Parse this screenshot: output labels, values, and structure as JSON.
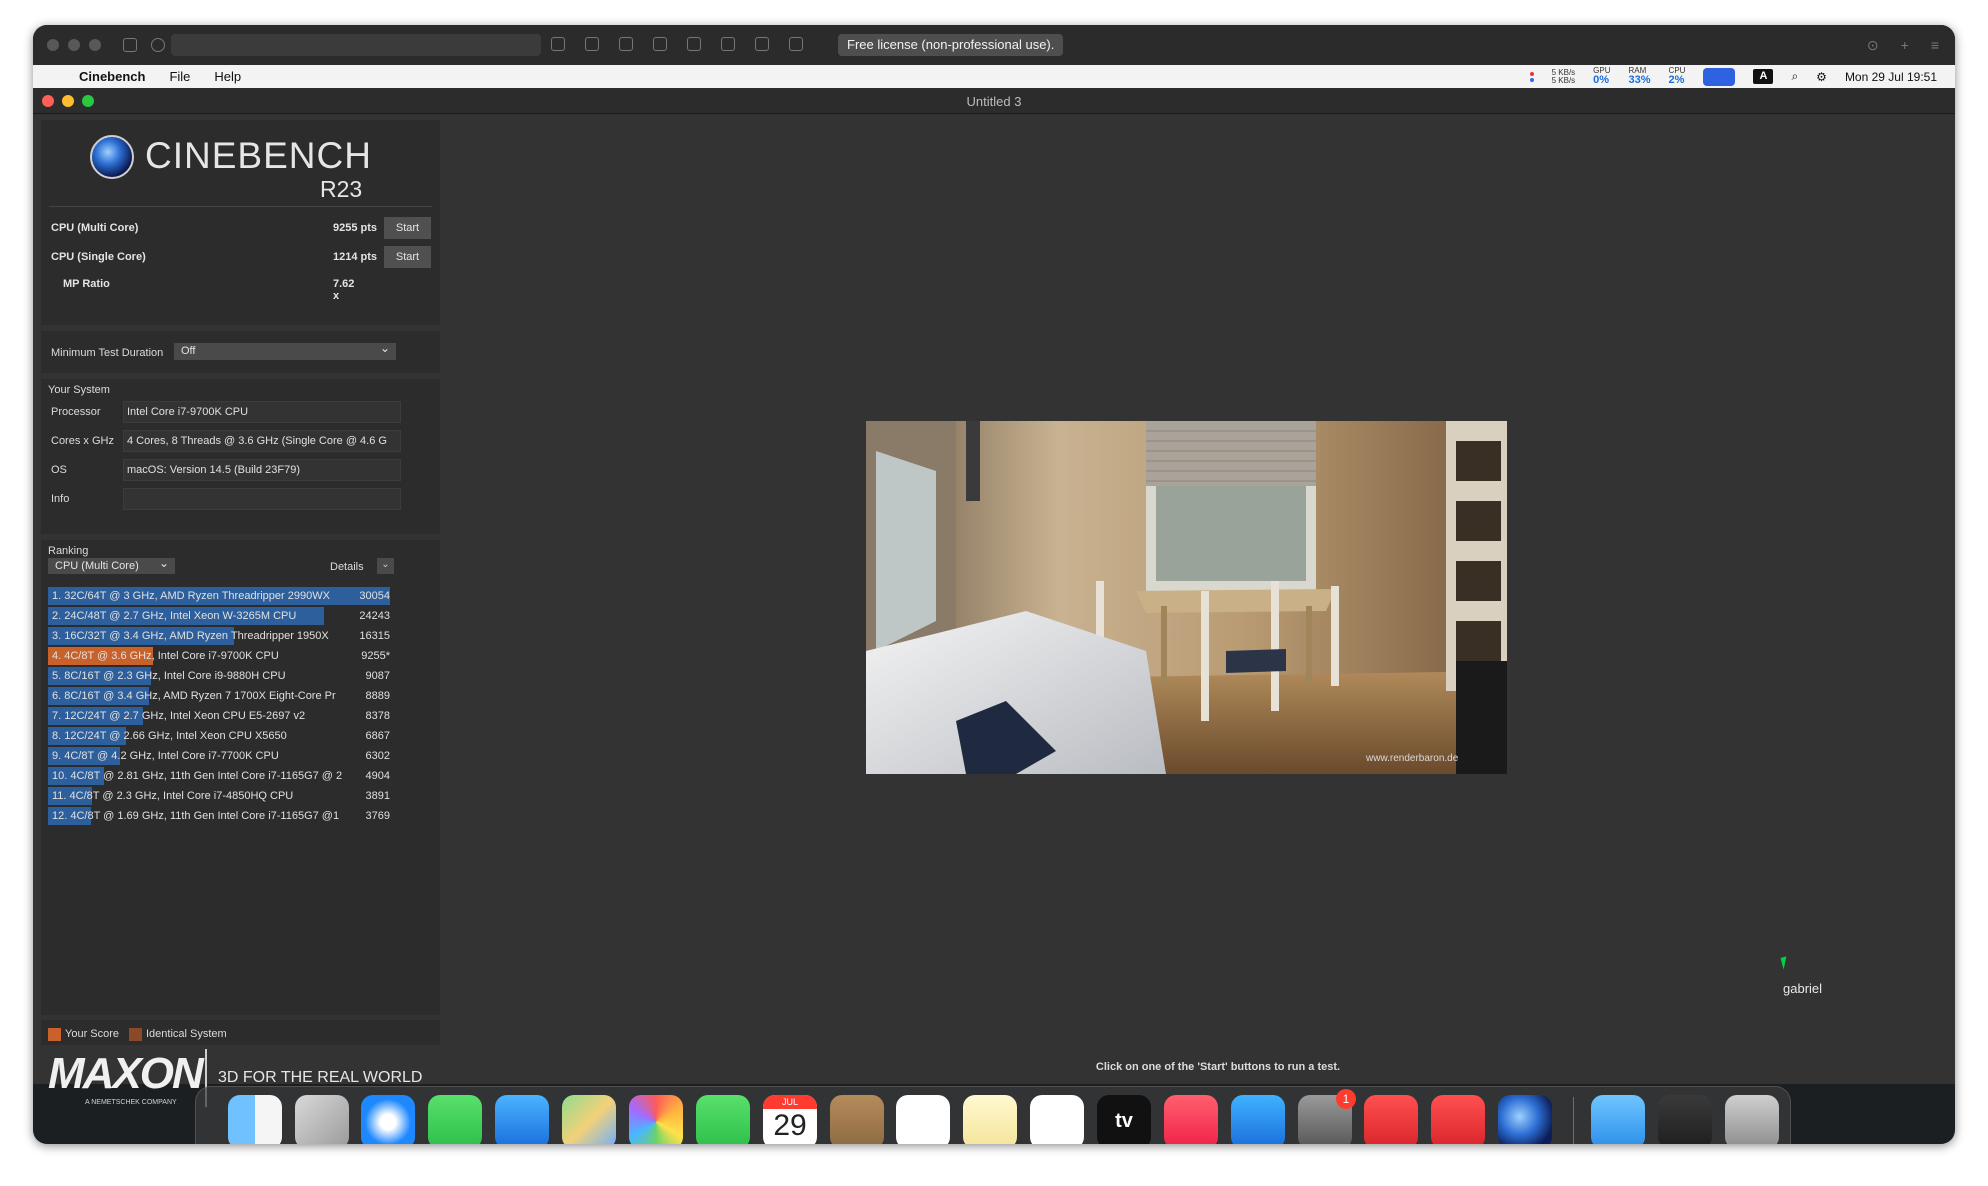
{
  "viewer": {
    "license": "Free license (non-professional use)."
  },
  "menubar": {
    "app_name": "Cinebench",
    "menus": [
      "File",
      "Help"
    ],
    "net_up": "5 KB/s",
    "net_down": "5 KB/s",
    "gpu_label": "GPU",
    "gpu_value": "0%",
    "ram_label": "RAM",
    "ram_value": "33%",
    "cpu_label": "CPU",
    "cpu_value": "2%",
    "input_source": "A",
    "clock": "Mon 29 Jul  19:51"
  },
  "window": {
    "title": "Untitled 3"
  },
  "logo": {
    "name": "CINEBENCH",
    "version": "R23"
  },
  "scores": {
    "multi": {
      "label": "CPU (Multi Core)",
      "value": "9255 pts",
      "button": "Start"
    },
    "single": {
      "label": "CPU (Single Core)",
      "value": "1214 pts",
      "button": "Start"
    },
    "mp_ratio": {
      "label": "MP Ratio",
      "value": "7.62 x"
    }
  },
  "duration": {
    "label": "Minimum Test Duration",
    "value": "Off"
  },
  "system": {
    "title": "Your System",
    "rows": [
      {
        "label": "Processor",
        "value": "Intel Core i7-9700K CPU"
      },
      {
        "label": "Cores x GHz",
        "value": "4 Cores, 8 Threads @ 3.6 GHz (Single Core @ 4.6 G"
      },
      {
        "label": "OS",
        "value": "macOS: Version 14.5 (Build 23F79)"
      },
      {
        "label": "Info",
        "value": ""
      }
    ]
  },
  "ranking": {
    "title": "Ranking",
    "selector": "CPU (Multi Core)",
    "details": "Details",
    "rows": [
      {
        "text": "1. 32C/64T @ 3 GHz, AMD Ryzen Threadripper 2990WX",
        "score": "30054",
        "fraction": 1.0,
        "kind": "other"
      },
      {
        "text": "2. 24C/48T @ 2.7 GHz, Intel Xeon W-3265M CPU",
        "score": "24243",
        "fraction": 0.807,
        "kind": "other"
      },
      {
        "text": "3. 16C/32T @ 3.4 GHz, AMD Ryzen Threadripper 1950X",
        "score": "16315",
        "fraction": 0.543,
        "kind": "other"
      },
      {
        "text": "4. 4C/8T @ 3.6 GHz, Intel Core i7-9700K CPU",
        "score": "9255*",
        "fraction": 0.308,
        "kind": "yours"
      },
      {
        "text": "5. 8C/16T @ 2.3 GHz, Intel Core i9-9880H CPU",
        "score": "9087",
        "fraction": 0.302,
        "kind": "other"
      },
      {
        "text": "6. 8C/16T @ 3.4 GHz, AMD Ryzen 7 1700X Eight-Core Pr",
        "score": "8889",
        "fraction": 0.296,
        "kind": "other"
      },
      {
        "text": "7. 12C/24T @ 2.7 GHz, Intel Xeon CPU E5-2697 v2",
        "score": "8378",
        "fraction": 0.279,
        "kind": "other"
      },
      {
        "text": "8. 12C/24T @ 2.66 GHz, Intel Xeon CPU X5650",
        "score": "6867",
        "fraction": 0.228,
        "kind": "other"
      },
      {
        "text": "9. 4C/8T @ 4.2 GHz, Intel Core i7-7700K CPU",
        "score": "6302",
        "fraction": 0.21,
        "kind": "other"
      },
      {
        "text": "10. 4C/8T @ 2.81 GHz, 11th Gen Intel Core i7-1165G7 @ 2",
        "score": "4904",
        "fraction": 0.163,
        "kind": "other"
      },
      {
        "text": "11. 4C/8T @ 2.3 GHz, Intel Core i7-4850HQ CPU",
        "score": "3891",
        "fraction": 0.129,
        "kind": "other"
      },
      {
        "text": "12. 4C/8T @ 1.69 GHz, 11th Gen Intel Core i7-1165G7 @1",
        "score": "3769",
        "fraction": 0.125,
        "kind": "other"
      }
    ],
    "colors": {
      "other": "#2d5f9c",
      "yours": "#c8622a",
      "identical": "#8a4a2a"
    }
  },
  "legend": {
    "your_score": "Your Score",
    "identical_system": "Identical System"
  },
  "maxon": {
    "word": "MAXON",
    "sub": "A NEMETSCHEK COMPANY",
    "tagline": "3D FOR THE REAL WORLD"
  },
  "render": {
    "watermark": "www.renderbaron.de"
  },
  "status": "Click on one of the 'Start' buttons to run a test.",
  "remote_user": "gabriel",
  "dock": {
    "calendar_month": "JUL",
    "calendar_day": "29",
    "badge": "1",
    "tv_label": "tv",
    "apps": [
      "finder-icon",
      "launchpad-icon",
      "safari-icon",
      "messages-icon",
      "mail-icon",
      "maps-icon",
      "photos-icon",
      "facetime-icon",
      "calendar-icon",
      "contacts-icon",
      "reminders-icon",
      "notes-icon",
      "freeform-icon",
      "apple-tv-icon",
      "music-icon",
      "app-store-icon",
      "system-settings-icon",
      "anydesk-icon",
      "anydesk-alt-icon",
      "cinebench-icon",
      "folder-icon",
      "activity-icon",
      "trash-icon"
    ]
  }
}
